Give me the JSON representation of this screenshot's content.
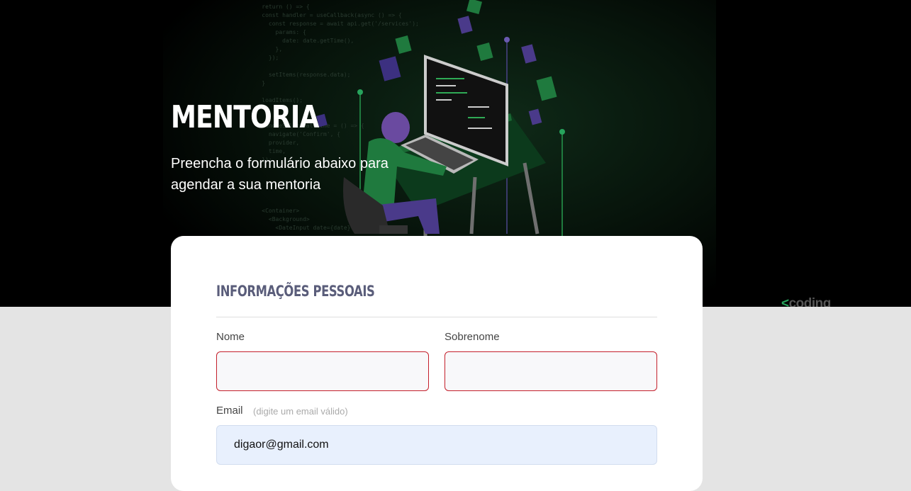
{
  "hero": {
    "title": "MENTORIA",
    "subtitle": "Preencha o formulário abaixo para agendar a sua mentoria",
    "code_lines": "    return () => {\n    const handler = useCallback(async () => {\n      const response = await api.get('/services');\n        params: {\n          date: date.getTime(),\n        },\n      });\n\n      setItems(response.data);\n    }\n\n    loadItems();\n\n\n    handleSelectDateTime = () => {\n      navigate('Confirm', {\n      provider,\n      time,\n    });\n\n\n\n\n\n    <Container>\n      <Background>\n        <DateInput date={date}\n\n        {hours}"
  },
  "brand": {
    "prefix": "<",
    "name": "coding"
  },
  "form": {
    "section_title": "INFORMAÇÕES PESSOAIS",
    "first_name": {
      "label": "Nome",
      "value": ""
    },
    "last_name": {
      "label": "Sobrenome",
      "value": ""
    },
    "email": {
      "label": "Email",
      "hint": "(digite um email válido)",
      "value": "digaor@gmail.com"
    }
  }
}
